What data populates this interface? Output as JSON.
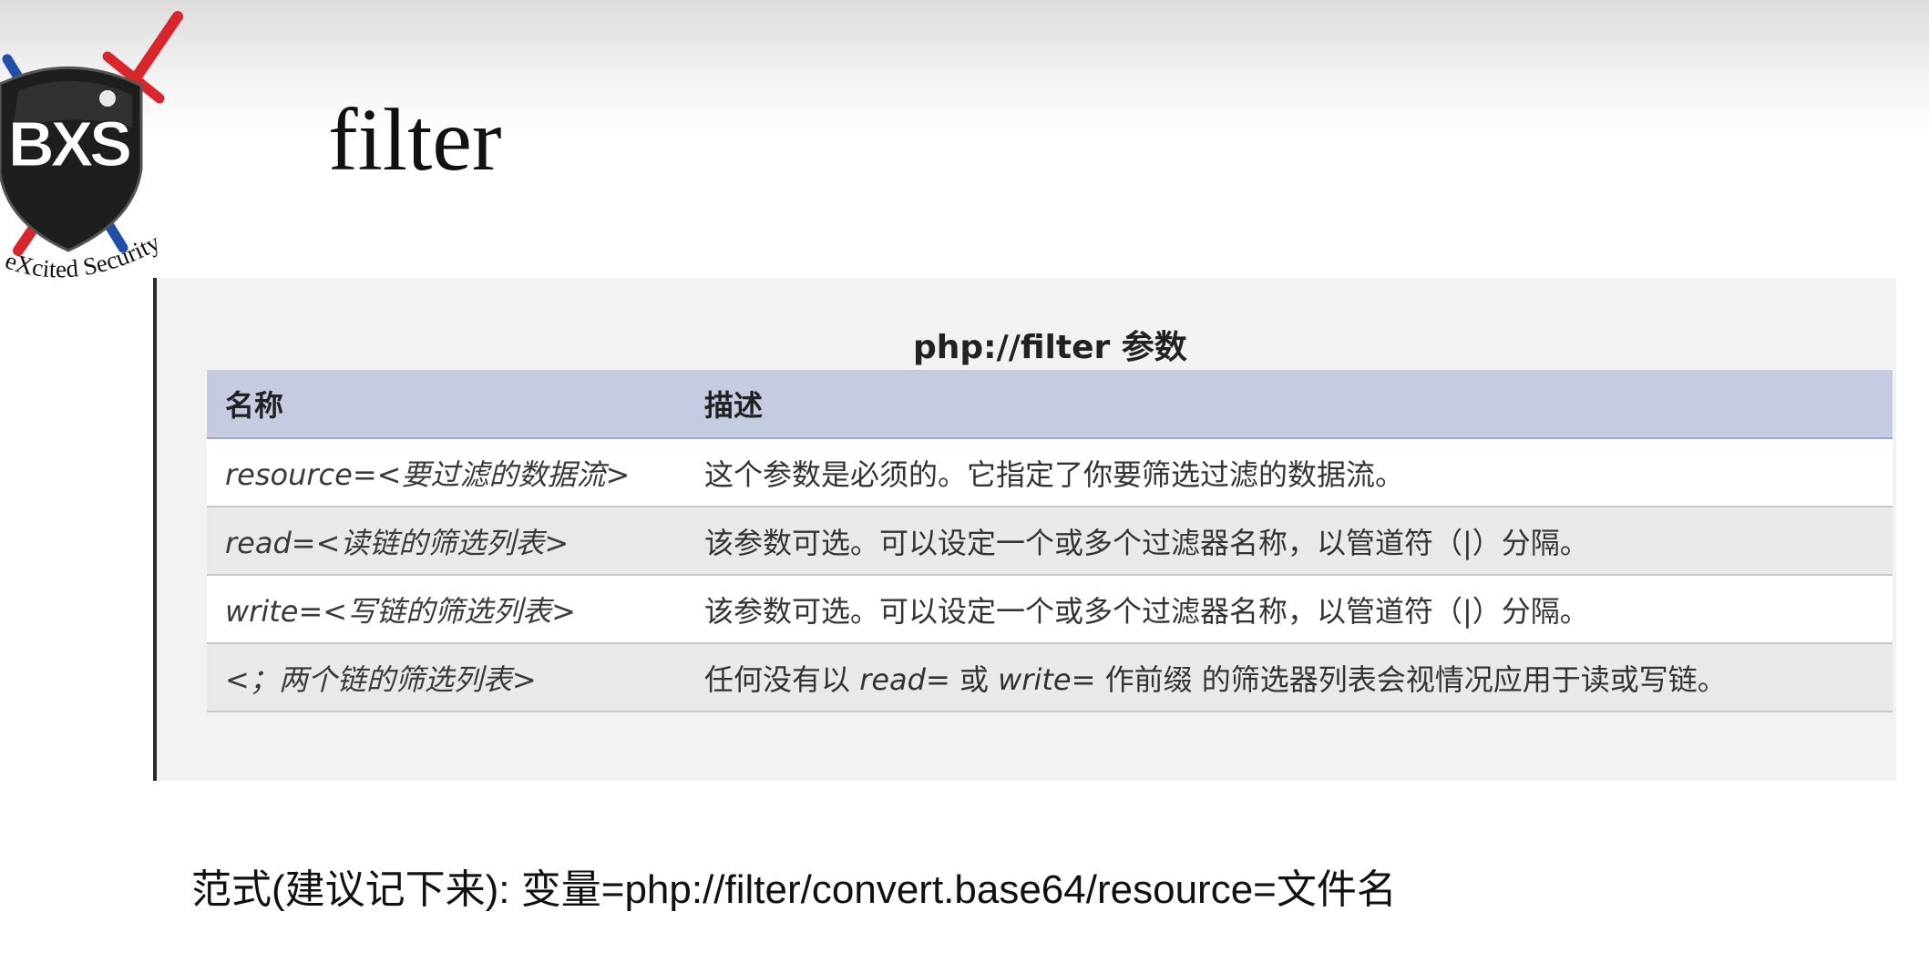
{
  "logo": {
    "letters": "BXS",
    "caption": "eXcited Security"
  },
  "slide": {
    "title": "filter"
  },
  "table": {
    "caption": "php://filter 参数",
    "headers": [
      "名称",
      "描述"
    ],
    "rows": [
      {
        "name": "resource=<要过滤的数据流>",
        "desc": "这个参数是必须的。它指定了你要筛选过滤的数据流。"
      },
      {
        "name": "read=<读链的筛选列表>",
        "desc": "该参数可选。可以设定一个或多个过滤器名称，以管道符（|）分隔。"
      },
      {
        "name": "write=<写链的筛选列表>",
        "desc": "该参数可选。可以设定一个或多个过滤器名称，以管道符（|）分隔。"
      },
      {
        "name": "<；两个链的筛选列表>",
        "desc_parts": [
          "任何没有以 ",
          "read=",
          " 或 ",
          "write=",
          " 作前缀 的筛选器列表会视情况应用于读或写链。"
        ]
      }
    ]
  },
  "summary": "范式(建议记下来): 变量=php://filter/convert.base64/resource=文件名",
  "colors": {
    "header_bg": "#c5cbe1",
    "panel_bg": "#f2f2f2",
    "logo_shield": "#1e1e1e",
    "logo_red": "#d9262c",
    "logo_blue": "#1f4fa8"
  }
}
